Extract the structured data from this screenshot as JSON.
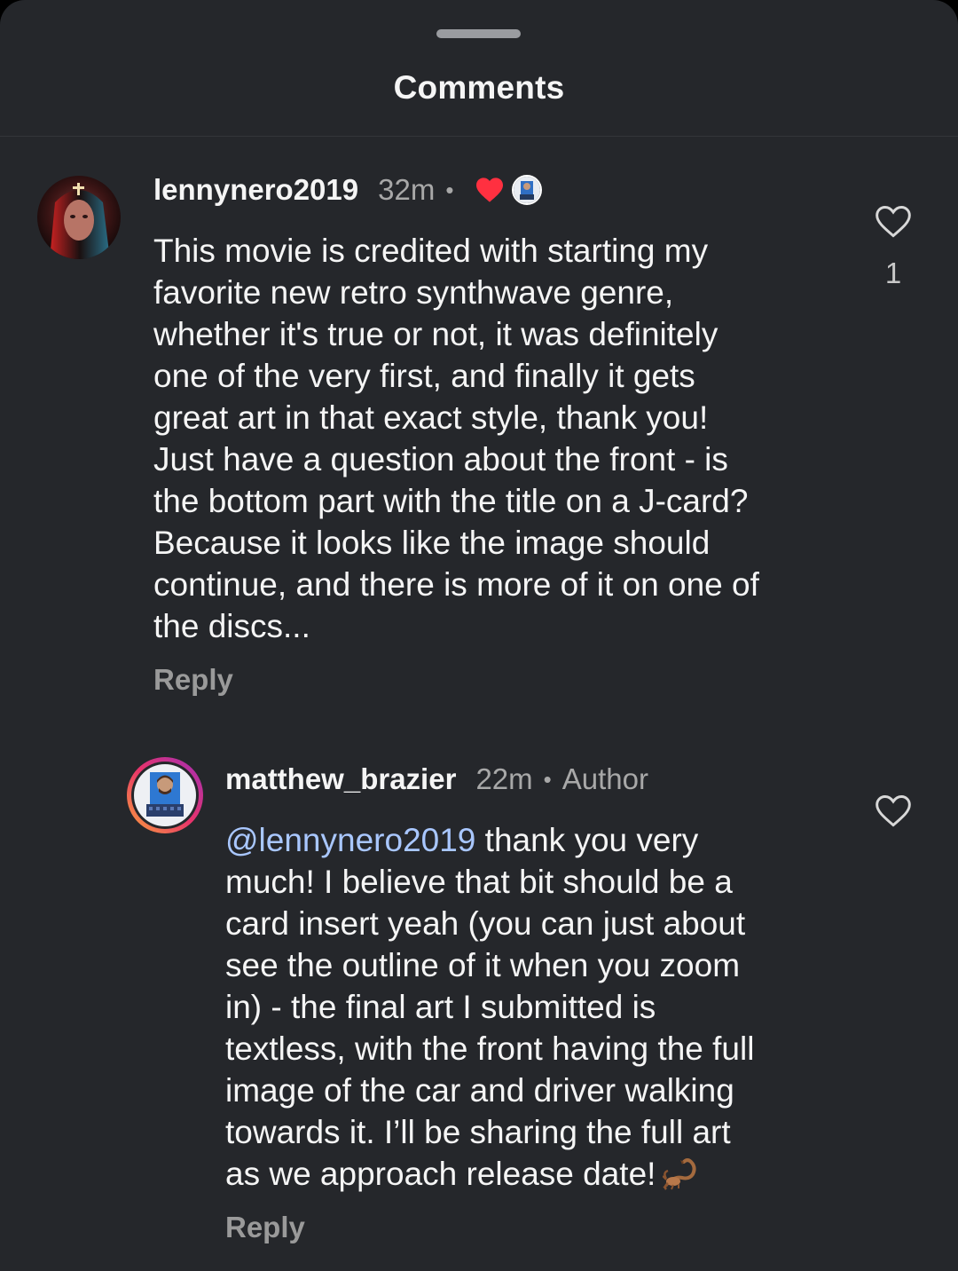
{
  "sheet": {
    "title": "Comments"
  },
  "comments": [
    {
      "username": "lennynero2019",
      "time": "32m",
      "separator": "•",
      "text": "This movie is credited with starting my\nfavorite new retro synthwave genre,\nwhether it's true or not, it was definitely\none of the very first, and finally it gets\ngreat art in that exact style, thank you!\nJust have a question about the front - is\nthe bottom part with the title on a J-card?\nBecause it looks like the image should\ncontinue, and there is more of it on one of\nthe discs...",
      "reply_label": "Reply",
      "like_count": "1",
      "liked_by_author": true
    },
    {
      "username": "matthew_brazier",
      "time": "22m",
      "separator": "•",
      "badge": "Author",
      "mention": "@lennynero2019",
      "text": " thank you very\nmuch! I believe that bit should be a\ncard insert yeah (you can just about\nsee the outline of it when you zoom\nin) - the final art I submitted is\ntextless, with the front having the full\nimage of the car and driver walking\ntowards it. I’ll be sharing the full art\nas we approach release date!",
      "emoji": "scorpion-emoji",
      "reply_label": "Reply"
    }
  ],
  "colors": {
    "background": "#25272b",
    "heart_liked": "#ff3040",
    "mention": "#a9c7ff",
    "muted": "#a8a8a8"
  }
}
